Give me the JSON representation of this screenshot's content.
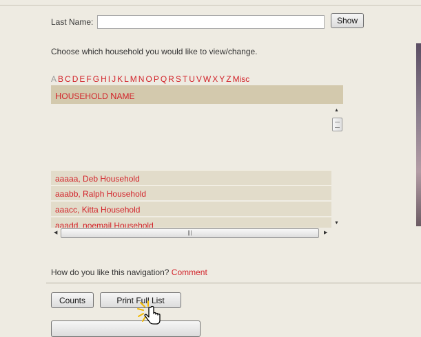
{
  "search": {
    "last_name_label": "Last Name:",
    "last_name_value": "",
    "show_label": "Show"
  },
  "instruction": "Choose which household you would like to view/change.",
  "alphabet": {
    "letters": [
      "A",
      "B",
      "C",
      "D",
      "E",
      "F",
      "G",
      "H",
      "I",
      "J",
      "K",
      "L",
      "M",
      "N",
      "O",
      "P",
      "Q",
      "R",
      "S",
      "T",
      "U",
      "V",
      "W",
      "X",
      "Y",
      "Z",
      "Misc"
    ],
    "disabled": [
      "A"
    ]
  },
  "household_table": {
    "header": "Household Name",
    "rows": [
      "aaaaa, Deb Household",
      "aaabb, Ralph Household",
      "aaacc, Kitta Household",
      "aaadd, noemail Household"
    ]
  },
  "feedback": {
    "question": "How do you like this navigation?",
    "link": "Comment"
  },
  "actions": {
    "counts_label": "Counts",
    "print_label": "Print Full List"
  },
  "colors": {
    "link": "#d2232a",
    "header_bg": "#d3c9ad",
    "row_bg": "#e2dcca",
    "page_bg": "#eeebe2"
  },
  "icons": [
    "scroll-up-icon",
    "scroll-down-icon",
    "scroll-left-icon",
    "scroll-right-icon",
    "hand-pointer-icon"
  ]
}
